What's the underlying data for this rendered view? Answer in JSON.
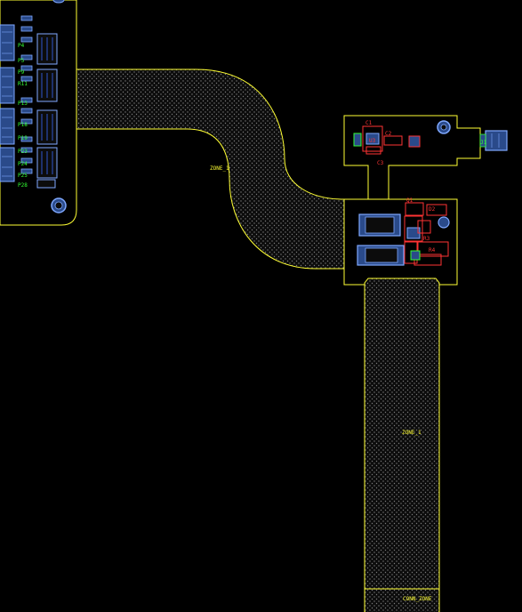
{
  "colors": {
    "background": "#000000",
    "outline": "#ffff33",
    "hatch": "#7a7a7a",
    "pad_fill": "#2a4a8a",
    "pad_border": "#7fa8ff",
    "silkscreen": "#33ff33",
    "component": "#ff3333",
    "label": "#d8d8d8"
  },
  "zones": {
    "flex_left": "ZONE_1",
    "flex_right": "ZONE_1",
    "stiffener": "CONN_ZONE"
  },
  "left_board": {
    "pin_labels": [
      "P4",
      "P5",
      "P9",
      "R11",
      "P13",
      "P18",
      "P19",
      "P23",
      "P24",
      "P25",
      "P28"
    ]
  },
  "upper_tab": {
    "labels": [
      "C1",
      "C2",
      "U3",
      "C3",
      "J1"
    ]
  },
  "mid_block": {
    "labels": [
      "Q1",
      "D2",
      "R3",
      "R4"
    ]
  }
}
